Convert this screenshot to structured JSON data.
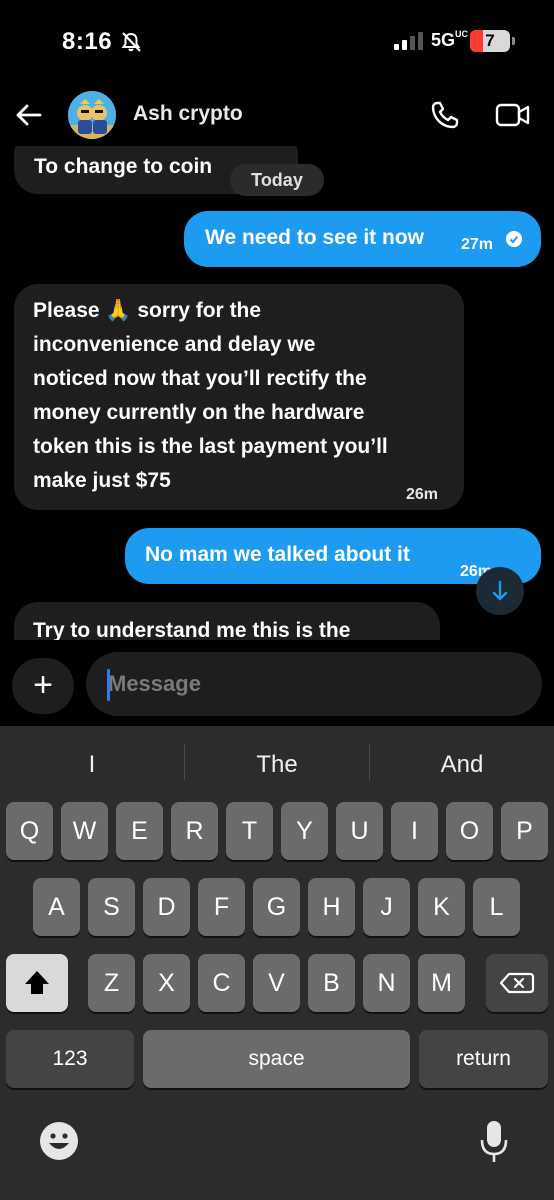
{
  "status": {
    "time": "8:16",
    "network": "5G",
    "network_sup": "UC",
    "battery": "7",
    "battery_level_percent": 7
  },
  "header": {
    "contact_name": "Ash crypto",
    "avatar": "avatar-image",
    "back_icon": "arrow-left-icon",
    "call_icon": "phone-icon",
    "video_icon": "video-camera-icon"
  },
  "chat": {
    "day_divider": "Today",
    "messages": [
      {
        "direction": "in",
        "text": "To change to coin",
        "time": ""
      },
      {
        "direction": "out",
        "text": "We need to see it now",
        "time": "27m"
      },
      {
        "direction": "in",
        "lines": [
          "Please 🙏 sorry for the",
          "inconvenience and delay we",
          "noticed now that you’ll rectify the",
          "money currently on the hardware",
          "token this is the last payment you’ll",
          "make just $75"
        ],
        "time": "26m"
      },
      {
        "direction": "out",
        "text": "No mam we talked about it",
        "time": "26m"
      },
      {
        "direction": "in",
        "text": "Try to understand me this is the",
        "time": ""
      }
    ]
  },
  "composer": {
    "placeholder": "Message",
    "plus_label": "+"
  },
  "keyboard": {
    "suggestions": [
      "I",
      "The",
      "And"
    ],
    "row1": [
      "Q",
      "W",
      "E",
      "R",
      "T",
      "Y",
      "U",
      "I",
      "O",
      "P"
    ],
    "row2": [
      "A",
      "S",
      "D",
      "F",
      "G",
      "H",
      "J",
      "K",
      "L"
    ],
    "row3": [
      "Z",
      "X",
      "C",
      "V",
      "B",
      "N",
      "M"
    ],
    "numbers_label": "123",
    "space_label": "space",
    "return_label": "return"
  },
  "colors": {
    "outgoing_bubble": "#1d9bf0",
    "incoming_bubble": "#1e1e1f",
    "background": "#000000"
  }
}
